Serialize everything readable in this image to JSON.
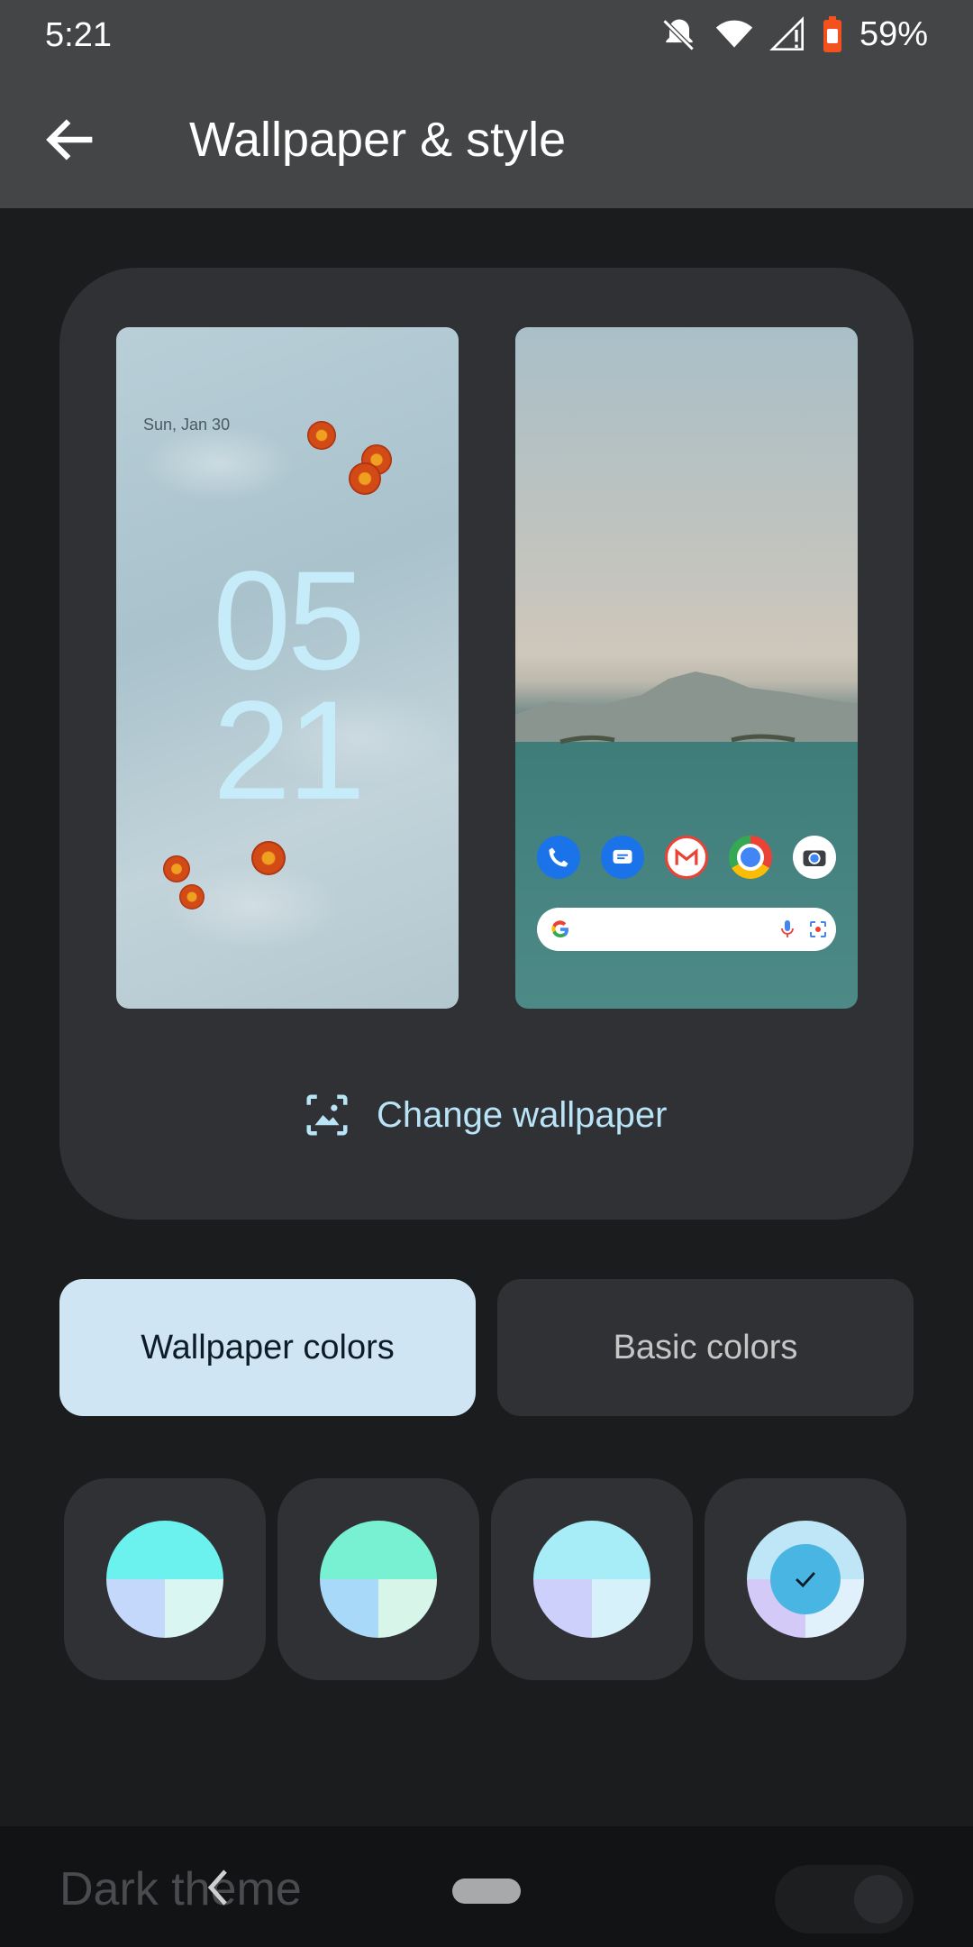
{
  "status_bar": {
    "time": "5:21",
    "battery": "59%"
  },
  "app_bar": {
    "title": "Wallpaper & style"
  },
  "lock_preview": {
    "date": "Sun, Jan 30",
    "hour": "05",
    "minute": "21"
  },
  "home_preview": {
    "apps": [
      "Phone",
      "Messages",
      "Gmail",
      "Chrome",
      "Camera"
    ]
  },
  "change_wallpaper_label": "Change wallpaper",
  "tabs": {
    "wallpaper_colors": "Wallpaper colors",
    "basic_colors": "Basic colors",
    "selected": "Wallpaper colors"
  },
  "swatches": [
    {
      "top": "#6cf2ee",
      "bottom_left": "#c3d8fb",
      "bottom_right": "#d9f6f3",
      "selected": false
    },
    {
      "top": "#78f0d2",
      "bottom_left": "#a9d9f8",
      "bottom_right": "#d8f5e9",
      "selected": false
    },
    {
      "top": "#a6edf8",
      "bottom_left": "#cdd0fb",
      "bottom_right": "#d6f1f9",
      "selected": false
    },
    {
      "top": "#bfe6f7",
      "bottom_left": "#d3caf7",
      "bottom_right": "#e0f1fb",
      "selected": true
    }
  ],
  "dark_theme": {
    "label": "Dark theme",
    "enabled": false
  },
  "colors": {
    "accent": "#b9e3f6",
    "selected_tab": "#cfe5f3",
    "check": "#48b5e2"
  }
}
